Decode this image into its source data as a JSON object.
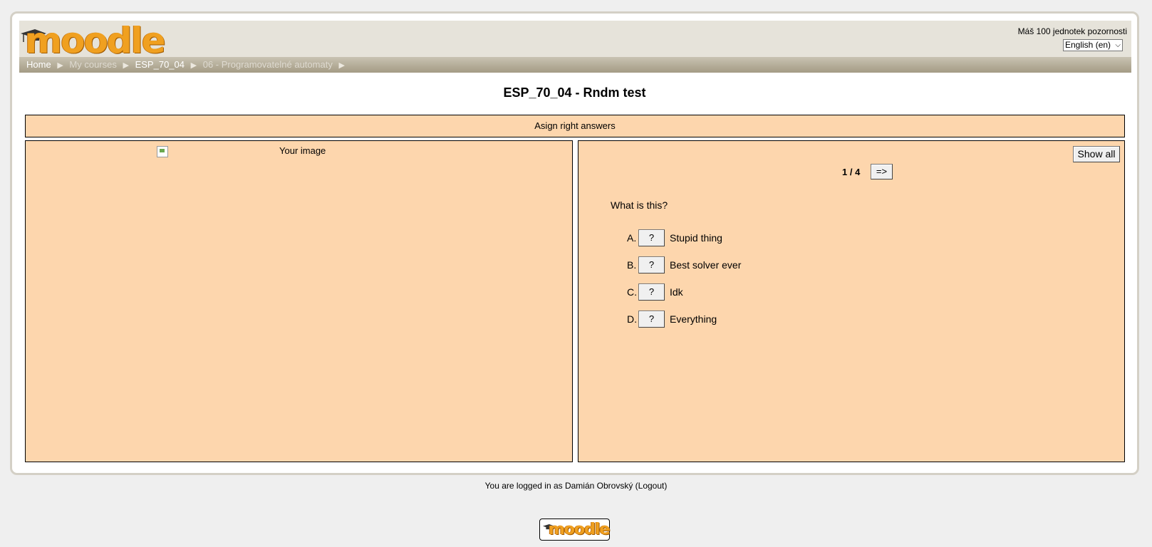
{
  "header": {
    "logo_text": "moodle",
    "attention_text": "Máš 100 jednotek pozornosti",
    "language_selected": "English (en)"
  },
  "breadcrumb": [
    {
      "label": "Home"
    },
    {
      "label": "My courses"
    },
    {
      "label": "ESP_70_04"
    },
    {
      "label": "06 - Programovatelné automaty"
    }
  ],
  "main": {
    "title": "ESP_70_04 - Rndm test",
    "instruction": "Asign right answers",
    "image_alt": "Your image",
    "show_all_label": "Show all",
    "counter": "1 / 4",
    "next_label": "=>",
    "question": "What is this?",
    "answers": [
      {
        "letter": "A.",
        "button": "?",
        "text": "Stupid thing"
      },
      {
        "letter": "B.",
        "button": "?",
        "text": "Best solver ever"
      },
      {
        "letter": "C.",
        "button": "?",
        "text": "Idk"
      },
      {
        "letter": "D.",
        "button": "?",
        "text": "Everything"
      }
    ]
  },
  "footer": {
    "logged_in_text": "You are logged in as Damián Obrovský (Logout)",
    "logo_text": "moodle"
  },
  "colors": {
    "panel_bg": "#fdd6ad",
    "logo_orange": "#f0a020",
    "navbar_bg": "#a49b85"
  }
}
